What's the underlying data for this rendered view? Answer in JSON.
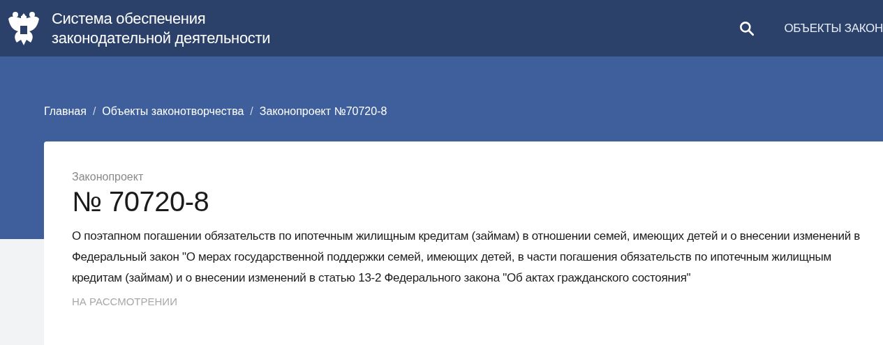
{
  "header": {
    "title_lines": [
      "Система обеспечения",
      "законодательной деятельности"
    ],
    "nav": [
      "ОБЪЕКТЫ ЗАКОН"
    ]
  },
  "breadcrumbs": [
    "Главная",
    "Объекты законотворчества",
    "Законопроект №70720-8"
  ],
  "breadcrumb_separators": [
    "/",
    "/"
  ],
  "bill": {
    "kind_label": "Законопроект",
    "number": "№ 70720-8",
    "description": "О поэтапном погашении обязательств по ипотечным жилищным кредитам (займам) в отношении семей, имеющих детей и о внесении изменений в Федеральный закон \"О мерах государственной поддержки семей, имеющих детей, в части погашения обязательств по ипотечным жилищным кредитам (займам) и о внесении изменений в статью 13-2 Федерального закона \"Об актах гражданского состояния\"",
    "status": "НА РАССМОТРЕНИИ"
  }
}
